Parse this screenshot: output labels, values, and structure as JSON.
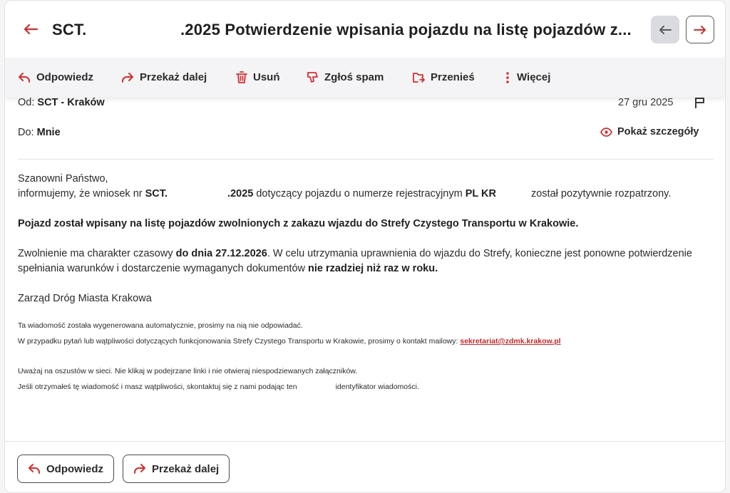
{
  "header": {
    "subject_prefix": "SCT.",
    "subject_main": ".2025 Potwierdzenie wpisania pojazdu na listę pojazdów z..."
  },
  "toolbar": {
    "reply": "Odpowiedz",
    "forward": "Przekaż dalej",
    "delete": "Usuń",
    "spam": "Zgłoś spam",
    "move": "Przenieś",
    "more": "Więcej"
  },
  "meta": {
    "from_label": "Od:",
    "from_value": "SCT - Kraków",
    "to_label": "Do:",
    "to_value": "Mnie",
    "date": "27 gru 2025",
    "details": "Pokaż szczegóły"
  },
  "body": {
    "greeting": "Szanowni Państwo,",
    "l1_a": "informujemy, że wniosek nr ",
    "l1_b": "SCT.",
    "l1_c": ".2025",
    "l1_d": " dotyczący pojazdu o numerze rejestracyjnym ",
    "l1_e": "PL KR",
    "l1_f": "został pozytywnie rozpatrzony.",
    "bold_line": "Pojazd został wpisany na listę pojazdów zwolnionych z zakazu wjazdu do Strefy Czystego Transportu w Krakowie.",
    "p3_a": "Zwolnienie ma charakter czasowy ",
    "p3_b": "do dnia 27.12.2026",
    "p3_c": ". W celu utrzymania uprawnienia do wjazdu do Strefy, konieczne jest ponowne potwierdzenie spełniania warunków i dostarczenie wymaganych dokumentów ",
    "p3_d": "nie rzadziej niż raz w roku.",
    "signature": "Zarząd Dróg Miasta Krakowa",
    "auto_note": "Ta wiadomość została wygenerowana automatycznie, prosimy na nią nie odpowiadać.",
    "contact_note": "W przypadku pytań lub wątpliwości dotyczących funkcjonowania Strefy Czystego Transportu w Krakowie, prosimy o kontakt mailowy: ",
    "contact_email": "sekretariat@zdmk.krakow.pl",
    "warn1": "Uważaj na oszustów w sieci. Nie klikaj w podejrzane linki i nie otwieraj niespodziewanych załączników.",
    "warn2_a": "Jeśli otrzymałeś tę wiadomość i masz wątpliwości, skontaktuj się z nami podając ten",
    "warn2_b": "identyfikator wiadomości."
  },
  "footer": {
    "reply": "Odpowiedz",
    "forward": "Przekaż dalej"
  },
  "colors": {
    "accent": "#d32f2f",
    "text": "#1f1f1f",
    "toolbar_bg": "#f4f4f6"
  },
  "icons": [
    "arrow-left-icon",
    "arrow-right-icon",
    "reply-icon",
    "forward-icon",
    "trash-icon",
    "spam-icon",
    "move-icon",
    "more-vertical-icon",
    "flag-icon",
    "eye-icon"
  ]
}
